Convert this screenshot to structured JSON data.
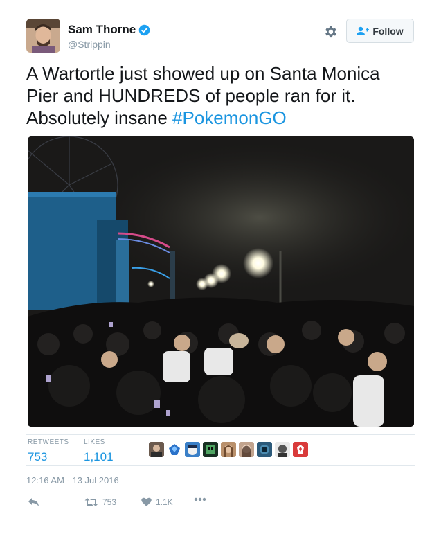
{
  "author": {
    "display_name": "Sam Thorne",
    "handle": "@Strippin",
    "verified": true
  },
  "header": {
    "follow_label": "Follow"
  },
  "tweet": {
    "text": "A Wartortle just showed up on Santa Monica Pier and HUNDREDS of people ran for it. Absolutely insane ",
    "hashtag": "#PokemonGO"
  },
  "stats": {
    "retweets_label": "RETWEETS",
    "retweets_value": "753",
    "likes_label": "LIKES",
    "likes_value": "1,101"
  },
  "timestamp": "12:16 AM - 13 Jul 2016",
  "actions": {
    "retweet_count": "753",
    "like_count": "1.1K"
  },
  "colors": {
    "accent": "#1b95e0",
    "muted": "#8899a6",
    "verified": "#1da1f2"
  }
}
